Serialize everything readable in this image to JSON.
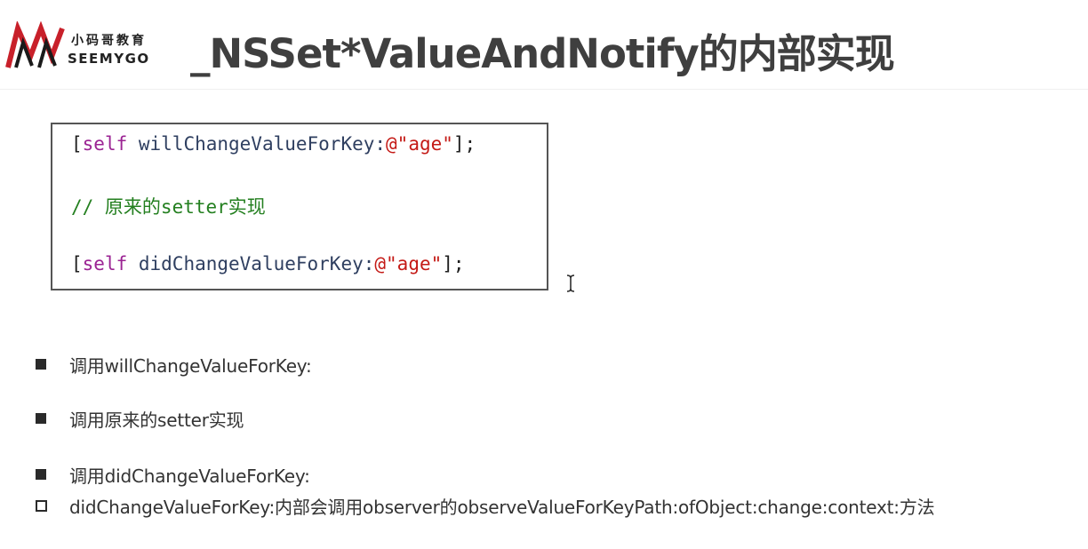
{
  "header": {
    "logo_cn": "小码哥教育",
    "logo_en": "SEEMYGO",
    "title": "_NSSet*ValueAndNotify的内部实现"
  },
  "code": {
    "line1": {
      "open": "[",
      "self": "self",
      "method": " willChangeValueForKey:",
      "string": "@\"age\"",
      "close": "];"
    },
    "line2": {
      "comment": "// 原来的setter实现"
    },
    "line3": {
      "open": "[",
      "self": "self",
      "method": " didChangeValueForKey:",
      "string": "@\"age\"",
      "close": "];"
    }
  },
  "bullets": [
    {
      "style": "filled-square",
      "text": "调用willChangeValueForKey:"
    },
    {
      "style": "filled-square",
      "text": "调用原来的setter实现"
    },
    {
      "style": "filled-square",
      "text": "调用didChangeValueForKey:"
    },
    {
      "style": "hollow-square",
      "text": "didChangeValueForKey:内部会调用observer的observeValueForKeyPath:ofObject:change:context:方法"
    }
  ],
  "colors": {
    "keyword": "#9b2393",
    "string": "#c41a16",
    "comment": "#237f1f",
    "logo_red": "#c8202a"
  },
  "icons": {
    "logo": "seemygo-logo-icon",
    "cursor": "text-cursor-icon"
  }
}
